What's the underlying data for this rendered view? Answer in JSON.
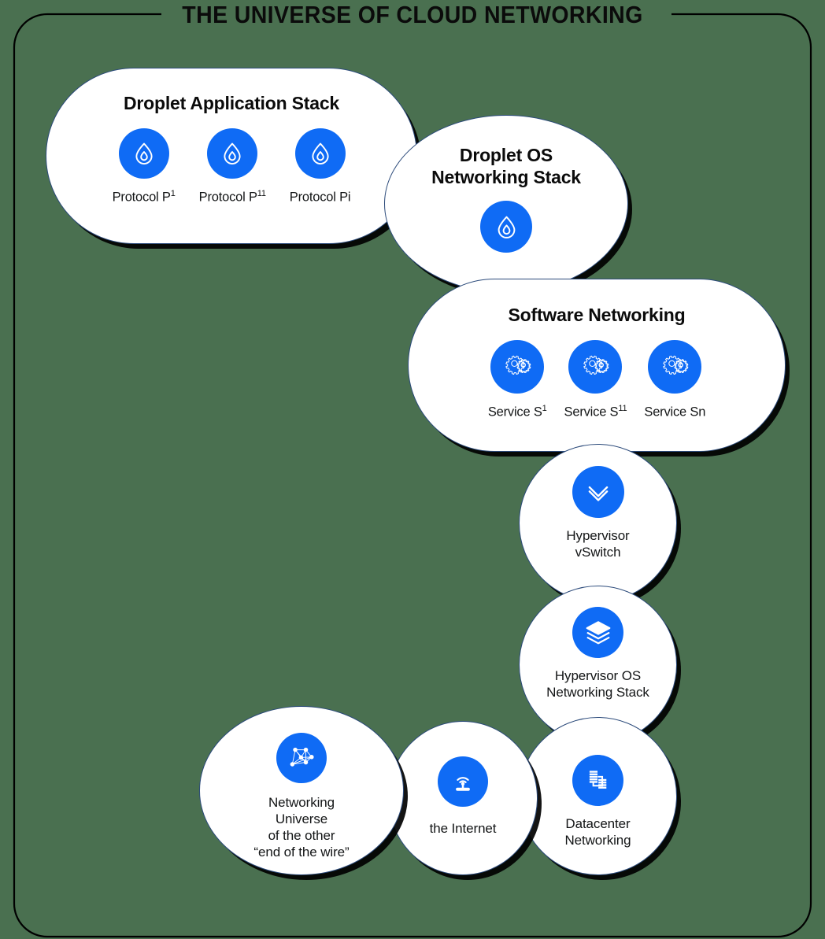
{
  "page": {
    "title": "THE UNIVERSE OF CLOUD NETWORKING",
    "background_color": "#4a7050",
    "accent_color": "#0f6bf5",
    "shape_fill": "#ffffff",
    "shape_stroke": "#2b4a7a",
    "shadow_color": "#000000",
    "text_color": "#131516"
  },
  "groups": {
    "droplet_app_stack": {
      "title": "Droplet Application Stack",
      "items": [
        {
          "icon": "droplet-icon",
          "label": "Protocol P",
          "sup": "1"
        },
        {
          "icon": "droplet-icon",
          "label": "Protocol P",
          "sup": "11"
        },
        {
          "icon": "droplet-icon",
          "label": "Protocol Pi",
          "sup": ""
        }
      ]
    },
    "droplet_os_networking_stack": {
      "title_line1": "Droplet OS",
      "title_line2": "Networking Stack",
      "icon": "droplet-icon"
    },
    "software_networking": {
      "title": "Software Networking",
      "items": [
        {
          "icon": "gears-icon",
          "label": "Service S",
          "sup": "1"
        },
        {
          "icon": "gears-icon",
          "label": "Service S",
          "sup": "11"
        },
        {
          "icon": "gears-icon",
          "label": "Service Sn",
          "sup": ""
        }
      ]
    },
    "hypervisor_vswitch": {
      "icon": "chevron-down-icon",
      "label_line1": "Hypervisor",
      "label_line2": "vSwitch"
    },
    "hypervisor_os_networking_stack": {
      "icon": "layers-icon",
      "label_line1": "Hypervisor OS",
      "label_line2": "Networking Stack"
    },
    "networking_universe": {
      "icon": "network-mesh-icon",
      "label_line1": "Networking",
      "label_line2": "Universe",
      "label_line3": "of the other",
      "label_line4": "“end of the wire”"
    },
    "the_internet": {
      "icon": "router-broadcast-icon",
      "label": "the Internet"
    },
    "datacenter_networking": {
      "icon": "datacenter-icon",
      "label_line1": "Datacenter",
      "label_line2": "Networking"
    }
  }
}
